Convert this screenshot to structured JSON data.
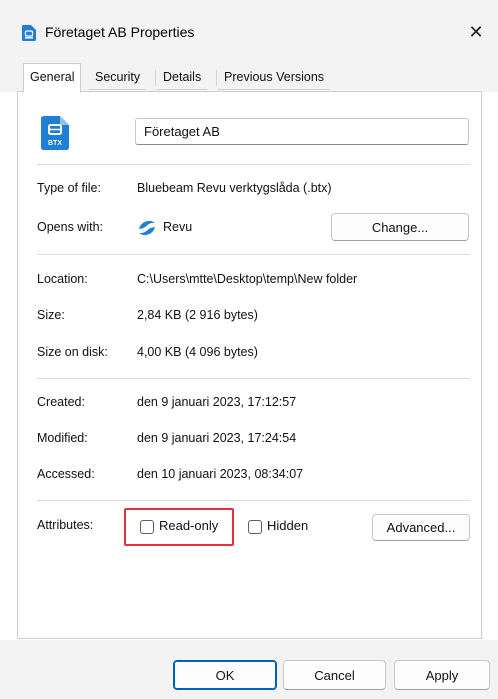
{
  "window": {
    "title": "Företaget AB Properties",
    "close_glyph": "✕",
    "title_icon": "btx-file-icon"
  },
  "tabs": [
    {
      "label": "General",
      "active": true
    },
    {
      "label": "Security",
      "active": false
    },
    {
      "label": "Details",
      "active": false
    },
    {
      "label": "Previous Versions",
      "active": false
    }
  ],
  "general": {
    "file_icon": "btx-file-icon",
    "file_icon_text": "BTX",
    "name_value": "Företaget AB",
    "type_label": "Type of file:",
    "type_value": "Bluebeam Revu verktygslåda (.btx)",
    "opens_label": "Opens with:",
    "opens_value": "Revu",
    "opens_icon": "revu-app-icon",
    "change_label": "Change...",
    "location_label": "Location:",
    "location_value": "C:\\Users\\mtte\\Desktop\\temp\\New folder",
    "size_label": "Size:",
    "size_value": "2,84 KB (2 916 bytes)",
    "size_disk_label": "Size on disk:",
    "size_disk_value": "4,00 KB (4 096 bytes)",
    "created_label": "Created:",
    "created_value": "den 9 januari 2023, 17:12:57",
    "modified_label": "Modified:",
    "modified_value": "den 9 januari 2023, 17:24:54",
    "accessed_label": "Accessed:",
    "accessed_value": "den 10 januari 2023, 08:34:07",
    "attributes_label": "Attributes:",
    "readonly_label": "Read-only",
    "readonly_checked": false,
    "hidden_label": "Hidden",
    "hidden_checked": false,
    "advanced_label": "Advanced...",
    "highlight_color": "#e2323a"
  },
  "footer": {
    "ok_label": "OK",
    "cancel_label": "Cancel",
    "apply_label": "Apply"
  },
  "colors": {
    "accent": "#005fb8",
    "btx_icon": "#1f7fd6"
  }
}
